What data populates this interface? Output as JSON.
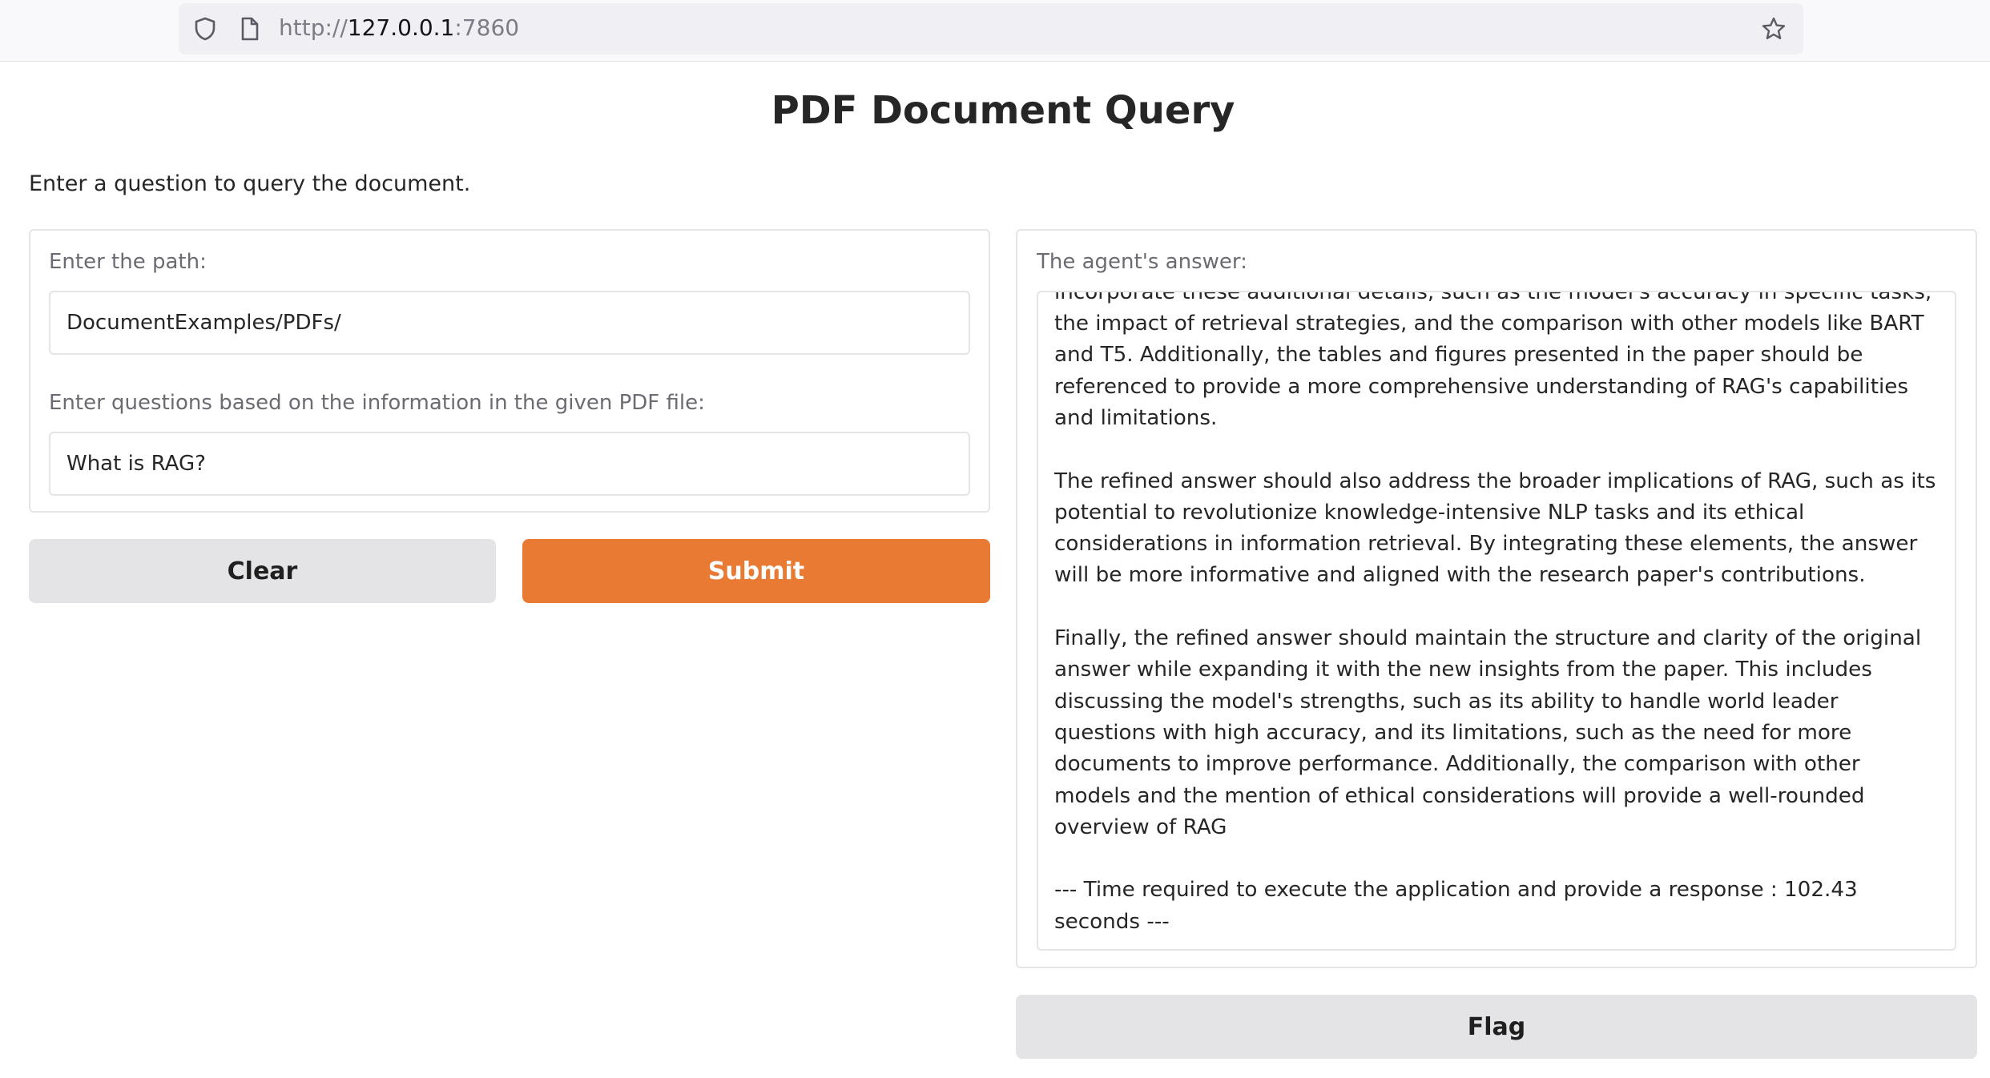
{
  "browser": {
    "url_prefix": "http://",
    "url_host": "127.0.0.1",
    "url_suffix": ":7860"
  },
  "page": {
    "title": "PDF Document Query",
    "description": "Enter a question to query the document."
  },
  "inputs": {
    "path_label": "Enter the path:",
    "path_value": "DocumentExamples/PDFs/",
    "question_label": "Enter questions based on the information in the given PDF file:",
    "question_value": "What is RAG?"
  },
  "buttons": {
    "clear": "Clear",
    "submit": "Submit",
    "flag": "Flag"
  },
  "output": {
    "label": "The agent's answer:",
    "answer": "components and advantages. However, the new context from the research paper offers more detailed information about RAG's performance, evaluation metrics, and specific applications. To better answer the query, the refined answer should incorporate these additional details, such as the model's accuracy in specific tasks, the impact of retrieval strategies, and the comparison with other models like BART and T5. Additionally, the tables and figures presented in the paper should be referenced to provide a more comprehensive understanding of RAG's capabilities and limitations.\n\nThe refined answer should also address the broader implications of RAG, such as its potential to revolutionize knowledge-intensive NLP tasks and its ethical considerations in information retrieval. By integrating these elements, the answer will be more informative and aligned with the research paper's contributions.\n\nFinally, the refined answer should maintain the structure and clarity of the original answer while expanding it with the new insights from the paper. This includes discussing the model's strengths, such as its ability to handle world leader questions with high accuracy, and its limitations, such as the need for more documents to improve performance. Additionally, the comparison with other models and the mention of ethical considerations will provide a well-rounded overview of RAG\n\n--- Time required to execute the application and provide a response : 102.43 seconds ---"
  },
  "colors": {
    "accent": "#e97a34",
    "button_grey": "#e4e4e7",
    "border": "#e5e5e8"
  },
  "icons": [
    "shield-icon",
    "page-icon",
    "star-icon"
  ]
}
